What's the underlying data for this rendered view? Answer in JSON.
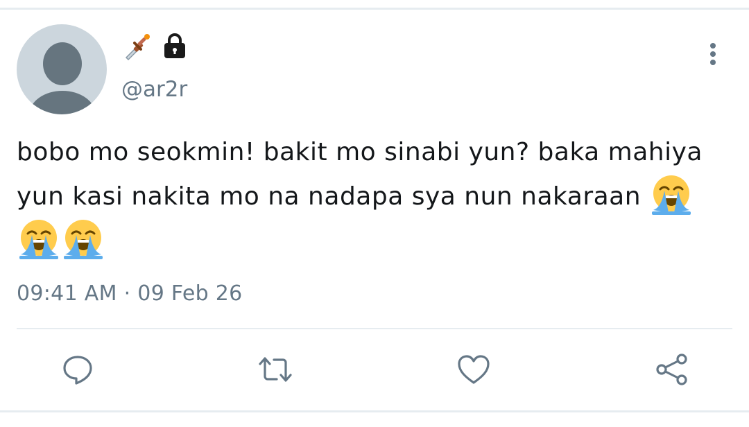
{
  "tweet": {
    "author": {
      "display_name_icons": [
        "dagger-icon",
        "lock-icon"
      ],
      "handle": "@ar2r"
    },
    "text": "bobo mo seokmin! bakit mo sinabi yun? baka mahiya yun kasi nakita mo na nadapa sya nun nakaraan",
    "trailing_emojis": [
      "loudly-crying-face-icon",
      "loudly-crying-face-icon",
      "loudly-crying-face-icon"
    ],
    "timestamp": "09:41 AM · 09 Feb 26"
  },
  "actions": [
    {
      "name": "reply",
      "icon": "comment-bubble-icon"
    },
    {
      "name": "retweet",
      "icon": "retweet-icon"
    },
    {
      "name": "like",
      "icon": "heart-icon"
    },
    {
      "name": "share",
      "icon": "share-icon"
    }
  ],
  "colors": {
    "secondary_text": "#657786",
    "avatar_bg": "#ccd6dd",
    "avatar_fg": "#66757f",
    "divider": "#e6ecf0"
  }
}
